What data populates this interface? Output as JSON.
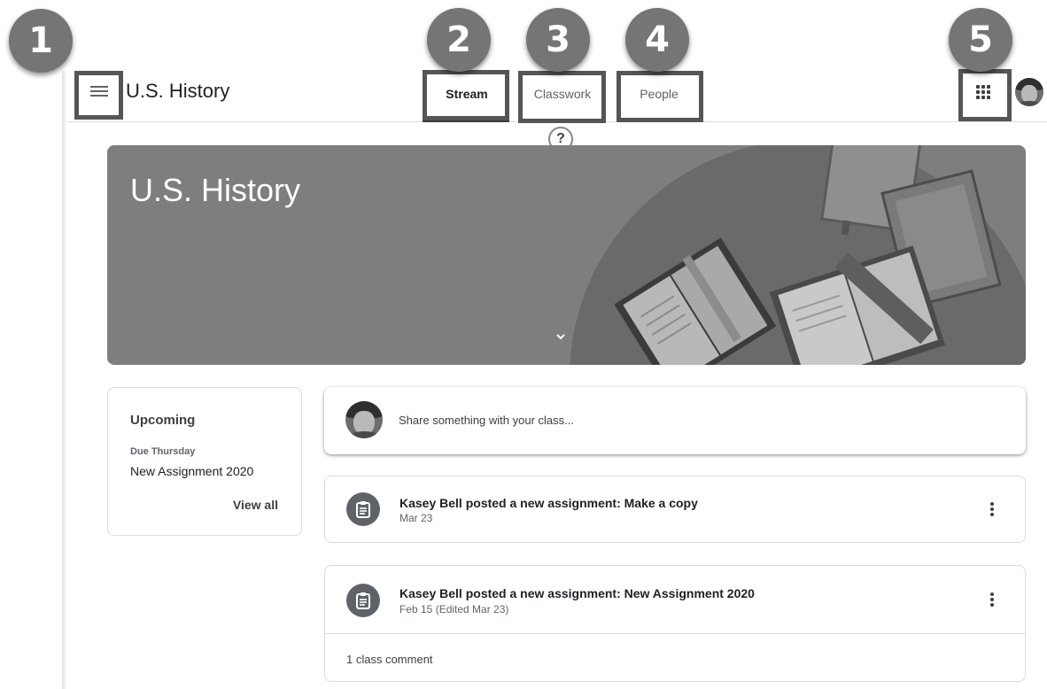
{
  "callouts": [
    "1",
    "2",
    "3",
    "4",
    "5"
  ],
  "header": {
    "course_title": "U.S. History",
    "tabs": [
      {
        "label": "Stream",
        "active": true
      },
      {
        "label": "Classwork",
        "active": false
      },
      {
        "label": "People",
        "active": false
      }
    ],
    "help_glyph": "?",
    "icons": [
      "menu-icon",
      "help-icon",
      "apps-icon",
      "avatar"
    ]
  },
  "banner": {
    "title": "U.S. History",
    "color": "#7e7e7e"
  },
  "upcoming": {
    "title": "Upcoming",
    "due_label": "Due Thursday",
    "item": "New Assignment 2020",
    "view_all": "View all"
  },
  "share": {
    "placeholder": "Share something with your class..."
  },
  "posts": [
    {
      "title": "Kasey Bell posted a new assignment: Make a copy",
      "date": "Mar 23",
      "icon": "assignment-icon"
    },
    {
      "title": "Kasey Bell posted a new assignment: New Assignment 2020",
      "date": "Feb 15 (Edited Mar 23)",
      "comments": "1 class comment",
      "icon": "assignment-icon"
    }
  ]
}
